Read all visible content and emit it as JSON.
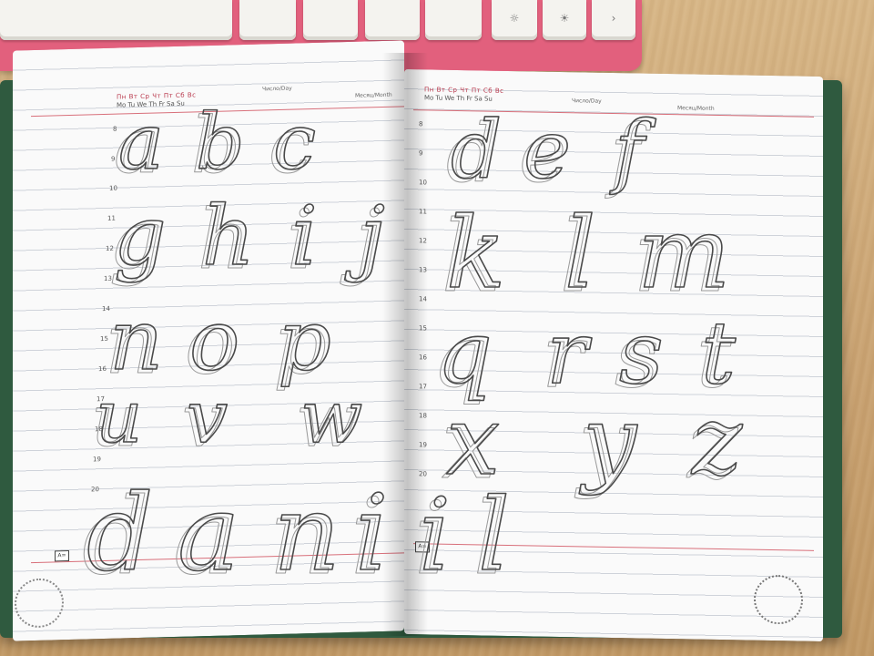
{
  "left_page": {
    "date_weekdays_top": "Пн Вт Ср Чт Пт Сб Вс",
    "date_weekdays_bottom": "Mo Tu We Th Fr Sa Su",
    "day_label": "Число/Day",
    "month_label": "Месяц/Month",
    "line_numbers": [
      "8",
      "9",
      "10",
      "11",
      "12",
      "13",
      "14",
      "15",
      "16",
      "17",
      "18",
      "19",
      "20"
    ],
    "tag": "A=",
    "rows": [
      [
        "a",
        "b",
        "c"
      ],
      [
        "g",
        "h",
        "i",
        "j"
      ],
      [
        "n",
        "o",
        "p"
      ],
      [
        "u",
        "v",
        "w"
      ],
      [
        "d",
        "a",
        "n",
        "i"
      ]
    ]
  },
  "right_page": {
    "date_weekdays_top": "Пн Вт Ср Чт Пт Сб Вс",
    "date_weekdays_bottom": "Mo Tu We Th Fr Sa Su",
    "day_label": "Число/Day",
    "month_label": "Месяц/Month",
    "line_numbers": [
      "8",
      "9",
      "10",
      "11",
      "12",
      "13",
      "14",
      "15",
      "16",
      "17",
      "18",
      "19",
      "20"
    ],
    "tag": "A=",
    "rows": [
      [
        "d",
        "e",
        "f"
      ],
      [
        "k",
        "l",
        "m"
      ],
      [
        "q",
        "r",
        "s",
        "t"
      ],
      [
        "x",
        "y",
        "z"
      ],
      [
        "i",
        "l"
      ]
    ]
  },
  "colors": {
    "pencil": "#4a4a4a",
    "book_cover": "#2f5a3f",
    "keyboard": "#e2607d",
    "desk": "#c9a676"
  }
}
